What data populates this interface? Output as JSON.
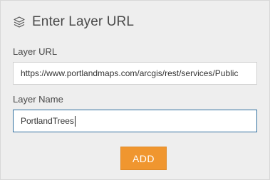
{
  "dialog": {
    "title": "Enter Layer URL",
    "title_icon": "layers-icon"
  },
  "layer_url": {
    "label": "Layer URL",
    "value": "https://www.portlandmaps.com/arcgis/rest/services/Public"
  },
  "layer_name": {
    "label": "Layer Name",
    "value": "PortlandTrees"
  },
  "actions": {
    "add_label": "ADD"
  },
  "colors": {
    "panel_background": "#eeeeee",
    "add_button": "#f0962f",
    "focused_border": "#2f6f9f"
  }
}
